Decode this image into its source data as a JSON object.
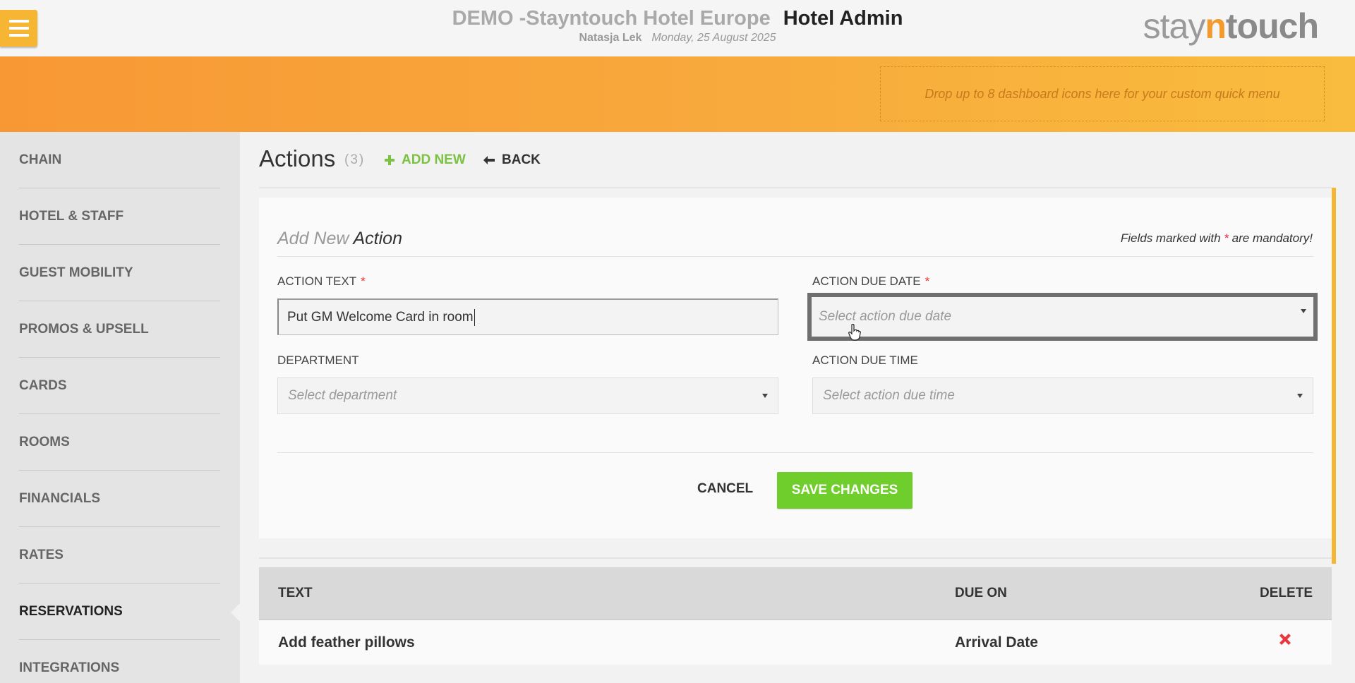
{
  "header": {
    "hotel_name": "DEMO -Stayntouch Hotel Europe",
    "app_name": "Hotel Admin",
    "user": "Natasja Lek",
    "date": "Monday, 25 August 2025",
    "logo": {
      "part1": "stay",
      "part2": "n",
      "part3": "touch"
    }
  },
  "quick_menu": {
    "placeholder": "Drop up to 8 dashboard icons here for your custom quick menu"
  },
  "sidebar": {
    "items": [
      {
        "label": "CHAIN"
      },
      {
        "label": "HOTEL & STAFF"
      },
      {
        "label": "GUEST MOBILITY"
      },
      {
        "label": "PROMOS & UPSELL"
      },
      {
        "label": "CARDS"
      },
      {
        "label": "ROOMS"
      },
      {
        "label": "FINANCIALS"
      },
      {
        "label": "RATES"
      },
      {
        "label": "RESERVATIONS",
        "active": true
      },
      {
        "label": "INTEGRATIONS"
      }
    ]
  },
  "page": {
    "title": "Actions",
    "count": "(3)",
    "add_new": "ADD NEW",
    "back": "BACK"
  },
  "form": {
    "title_light": "Add New",
    "title_dark": "Action",
    "mandatory_pre": "Fields marked with",
    "mandatory_star": "*",
    "mandatory_post": "are mandatory!",
    "action_text_label": "ACTION TEXT",
    "action_text_value": "Put GM Welcome Card in room",
    "due_date_label": "ACTION DUE DATE",
    "due_date_placeholder": "Select action due date",
    "department_label": "DEPARTMENT",
    "department_placeholder": "Select department",
    "due_time_label": "ACTION DUE TIME",
    "due_time_placeholder": "Select action due time",
    "required_star": "*",
    "cancel": "CANCEL",
    "save": "SAVE CHANGES"
  },
  "table": {
    "columns": [
      "TEXT",
      "DUE ON",
      "DELETE"
    ],
    "rows": [
      {
        "text": "Add feather pillows",
        "due_on": "Arrival Date"
      }
    ]
  },
  "colors": {
    "accent_orange": "#f89835",
    "accent_yellow": "#f6b533",
    "save_green": "#6fce2b",
    "add_new_green": "#7cc242",
    "delete_red": "#e8373e"
  }
}
